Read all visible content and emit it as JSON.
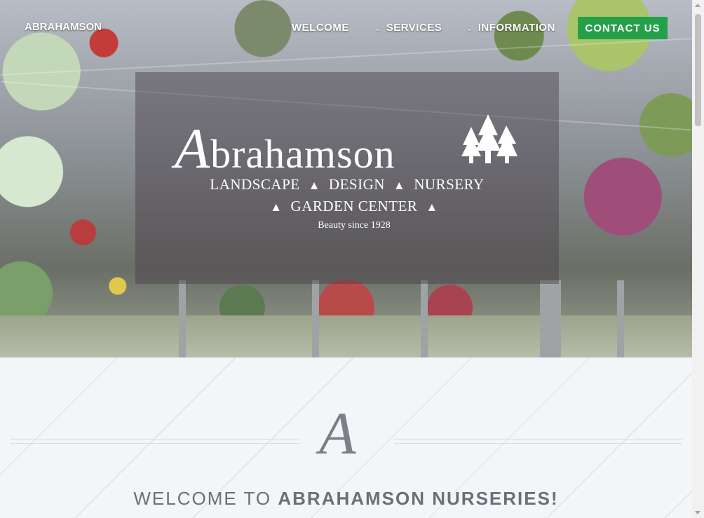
{
  "nav": {
    "brand": "ABRAHAMSON",
    "items": [
      {
        "label": "WELCOME",
        "has_dropdown": false
      },
      {
        "label": "SERVICES",
        "has_dropdown": true
      },
      {
        "label": "INFORMATION",
        "has_dropdown": true
      }
    ],
    "cta_label": "CONTACT US"
  },
  "hero": {
    "logo_word": "brahamson",
    "logo_initial": "A",
    "services": [
      "LANDSCAPE",
      "DESIGN",
      "NURSERY"
    ],
    "garden_center": "GARDEN CENTER",
    "triangle": "▲",
    "tagline": "Beauty since 1928"
  },
  "intro": {
    "monogram": "A",
    "welcome_prefix": "WELCOME TO",
    "welcome_name": "ABRAHAMSON NURSERIES!"
  },
  "colors": {
    "cta": "#24a148",
    "text_muted": "#6b7077"
  },
  "icons": [
    "chevron-down-icon",
    "tree-icon"
  ]
}
